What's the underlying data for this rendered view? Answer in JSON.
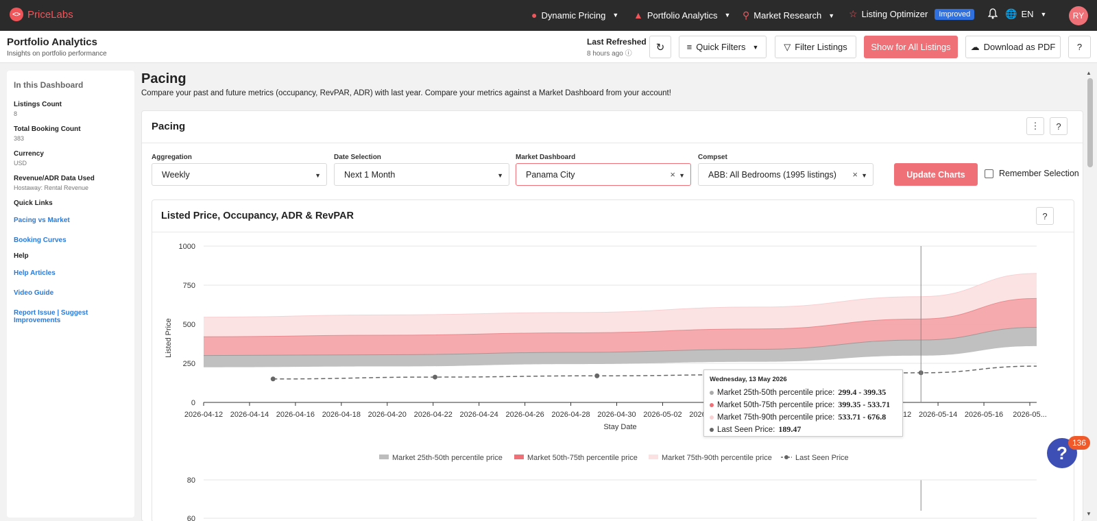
{
  "nav": {
    "logo": "PriceLabs",
    "items": [
      {
        "label": "Dynamic Pricing",
        "icon": "flame-icon"
      },
      {
        "label": "Portfolio Analytics",
        "icon": "bar-chart-icon"
      },
      {
        "label": "Market Research",
        "icon": "magnifier-chart-icon"
      },
      {
        "label": "Listing Optimizer",
        "icon": "star-icon"
      }
    ],
    "improved_badge": "Improved",
    "language": "EN",
    "avatar": "RY"
  },
  "header": {
    "title": "Portfolio Analytics",
    "subtitle": "Insights on portfolio performance",
    "last_refreshed_label": "Last Refreshed",
    "last_refreshed_time": "8 hours ago",
    "quick_filters": "Quick Filters",
    "filter_listings": "Filter Listings",
    "show_all": "Show for All Listings",
    "download_pdf": "Download as PDF"
  },
  "sidebar": {
    "heading": "In this Dashboard",
    "stats": [
      {
        "label": "Listings Count",
        "value": "8"
      },
      {
        "label": "Total Booking Count",
        "value": "383"
      },
      {
        "label": "Currency",
        "value": "USD"
      },
      {
        "label": "Revenue/ADR Data Used",
        "value": "Hostaway: Rental Revenue"
      }
    ],
    "quick_links_heading": "Quick Links",
    "quick_links": [
      "Pacing vs Market",
      "Booking Curves"
    ],
    "help_heading": "Help",
    "help_links": [
      "Help Articles",
      "Video Guide",
      "Report Issue | Suggest Improvements"
    ]
  },
  "main": {
    "title": "Pacing",
    "description": "Compare your past and future metrics (occupancy, RevPAR, ADR) with last year. Compare your metrics against a Market Dashboard from your account!",
    "card_title": "Pacing",
    "filters": {
      "aggregation_label": "Aggregation",
      "aggregation_value": "Weekly",
      "date_label": "Date Selection",
      "date_value": "Next 1 Month",
      "market_label": "Market Dashboard",
      "market_value": "Panama City",
      "compset_label": "Compset",
      "compset_value": "ABB: All Bedrooms (1995 listings)",
      "update_button": "Update Charts",
      "remember": "Remember Selection"
    },
    "chart_title": "Listed Price, Occupancy, ADR & RevPAR"
  },
  "chart_data": {
    "type": "area",
    "xlabel": "Stay Date",
    "ylabel": "Listed Price",
    "ylim": [
      0,
      1000
    ],
    "yticks": [
      0,
      250,
      500,
      750,
      1000
    ],
    "x_tick_labels": [
      "2026-04-12",
      "2026-04-14",
      "2026-04-16",
      "2026-04-18",
      "2026-04-20",
      "2026-04-22",
      "2026-04-24",
      "2026-04-26",
      "2026-04-28",
      "2026-04-30",
      "2026-05-02",
      "2026-05-04",
      "2026-05-06",
      "2026-05-08",
      "2026-05-10",
      "2026-05-12",
      "2026-05-14",
      "2026-05-16",
      "2026-05..."
    ],
    "x_range": [
      "2026-04-12",
      "2026-05-18"
    ],
    "bands": [
      {
        "name": "Market 25th-50th percentile price",
        "color": "#bdbdbd",
        "points": [
          [
            "2026-04-12",
            225,
            300
          ],
          [
            "2026-04-20",
            230,
            305
          ],
          [
            "2026-04-28",
            245,
            320
          ],
          [
            "2026-05-06",
            260,
            340
          ],
          [
            "2026-05-13",
            299.4,
            399.35
          ],
          [
            "2026-05-18",
            360,
            480
          ]
        ]
      },
      {
        "name": "Market 50th-75th percentile price",
        "color": "#f4a5a9",
        "points": [
          [
            "2026-04-12",
            300,
            420
          ],
          [
            "2026-04-20",
            305,
            430
          ],
          [
            "2026-04-28",
            320,
            445
          ],
          [
            "2026-05-06",
            340,
            470
          ],
          [
            "2026-05-13",
            399.35,
            533.71
          ],
          [
            "2026-05-18",
            480,
            665
          ]
        ]
      },
      {
        "name": "Market 75th-90th percentile price",
        "color": "#fce1e2",
        "points": [
          [
            "2026-04-12",
            420,
            545
          ],
          [
            "2026-04-20",
            430,
            560
          ],
          [
            "2026-04-28",
            445,
            575
          ],
          [
            "2026-05-06",
            470,
            610
          ],
          [
            "2026-05-13",
            533.71,
            676.8
          ],
          [
            "2026-05-18",
            665,
            825
          ]
        ]
      }
    ],
    "line": {
      "name": "Last Seen Price",
      "color": "#666666",
      "points": [
        [
          "2026-04-15",
          150
        ],
        [
          "2026-04-22",
          162
        ],
        [
          "2026-04-29",
          170
        ],
        [
          "2026-05-06",
          178
        ],
        [
          "2026-05-13",
          189.47
        ],
        [
          "2026-05-18",
          232
        ]
      ]
    },
    "legend_position": "bottom",
    "next_chart_yticks": [
      80,
      60
    ]
  },
  "tooltip": {
    "date": "Wednesday, 13 May 2026",
    "rows": [
      {
        "label": "Market 25th-50th percentile price:",
        "value": "299.4 - 399.35",
        "color": "#aaaaaa"
      },
      {
        "label": "Market 50th-75th percentile price:",
        "value": "399.35 - 533.71",
        "color": "#f07077"
      },
      {
        "label": "Market 75th-90th percentile price:",
        "value": "533.71 - 676.8",
        "color": "#fad0d2"
      },
      {
        "label": "Last Seen Price:",
        "value": "189.47",
        "color": "#666666"
      }
    ]
  },
  "help_fab": {
    "count": "136"
  }
}
